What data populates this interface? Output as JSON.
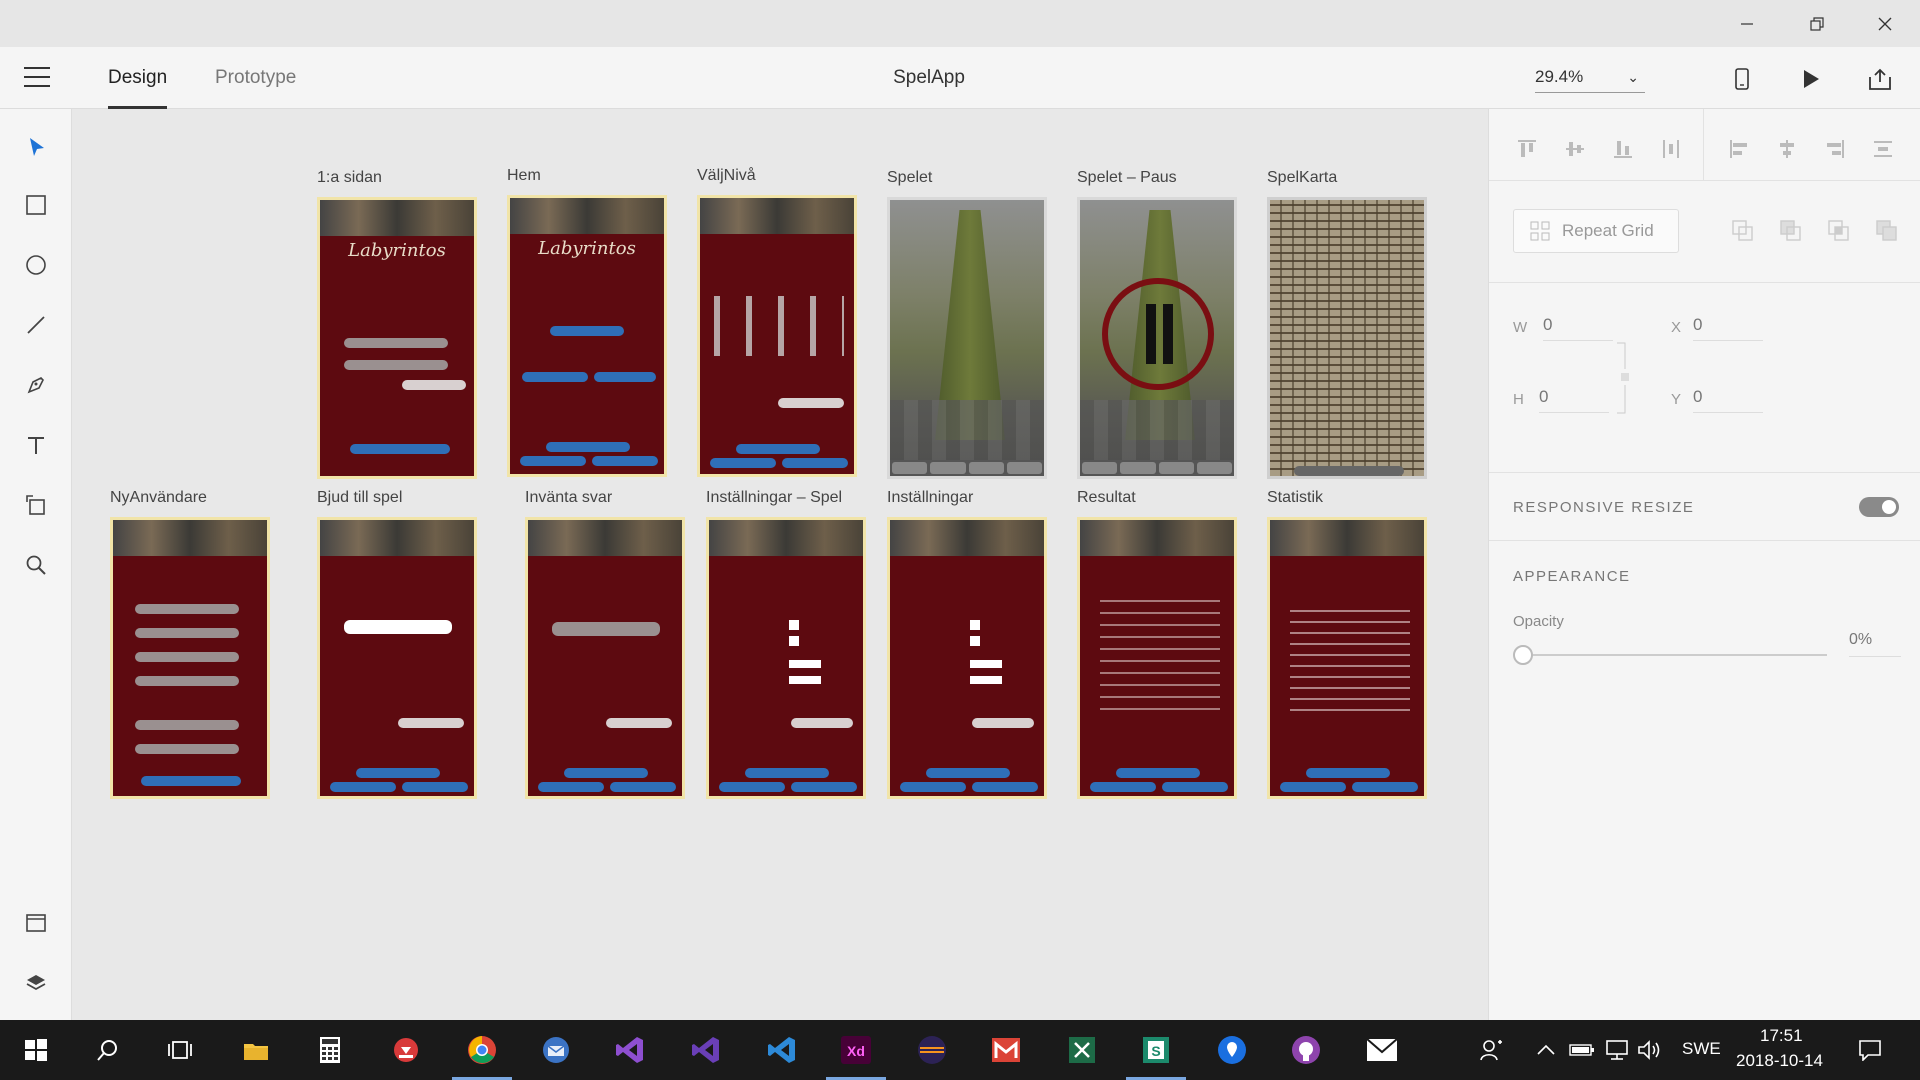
{
  "window": {
    "minimize_icon": "minimize-icon",
    "restore_icon": "restore-icon",
    "close_icon": "close-icon"
  },
  "header": {
    "menu_icon": "hamburger-menu-icon",
    "tabs": [
      {
        "label": "Design",
        "active": true
      },
      {
        "label": "Prototype",
        "active": false
      }
    ],
    "title": "SpelApp",
    "zoom": "29.4%",
    "icons": [
      "device-preview-icon",
      "play-icon",
      "share-icon"
    ]
  },
  "tools": [
    "select-icon",
    "rectangle-icon",
    "ellipse-icon",
    "line-icon",
    "pen-icon",
    "text-icon",
    "artboard-icon",
    "zoom-icon",
    "assets-icon",
    "layers-icon"
  ],
  "artboards": [
    {
      "title": "1:a sidan",
      "logo": "Labyrintos",
      "kind": "login"
    },
    {
      "title": "Hem",
      "logo": "Labyrintos",
      "kind": "home"
    },
    {
      "title": "VäljNivå",
      "kind": "level"
    },
    {
      "title": "Spelet",
      "kind": "game"
    },
    {
      "title": "Spelet – Paus",
      "kind": "pause"
    },
    {
      "title": "SpelKarta",
      "kind": "map"
    },
    {
      "title": "NyAnvändare",
      "kind": "form"
    },
    {
      "title": "Bjud till spel",
      "kind": "invite"
    },
    {
      "title": "Invänta svar",
      "kind": "wait"
    },
    {
      "title": "Inställningar – Spel",
      "kind": "settings"
    },
    {
      "title": "Inställningar",
      "kind": "settings"
    },
    {
      "title": "Resultat",
      "kind": "result"
    },
    {
      "title": "Statistik",
      "kind": "stats"
    }
  ],
  "panel": {
    "repeat_grid": "Repeat Grid",
    "w_label": "W",
    "w_value": "0",
    "x_label": "X",
    "x_value": "0",
    "h_label": "H",
    "h_value": "0",
    "y_label": "Y",
    "y_value": "0",
    "responsive_resize": "RESPONSIVE RESIZE",
    "appearance": "APPEARANCE",
    "opacity_label": "Opacity",
    "opacity_value": "0%"
  },
  "taskbar": {
    "language": "SWE",
    "time": "17:51",
    "date": "2018-10-14"
  },
  "colors": {
    "artboard_bg": "#5d0a10",
    "accent_blue": "#2f6fb8",
    "frame_border": "#f1e4a8",
    "taskbar": "#1a1a1a"
  }
}
